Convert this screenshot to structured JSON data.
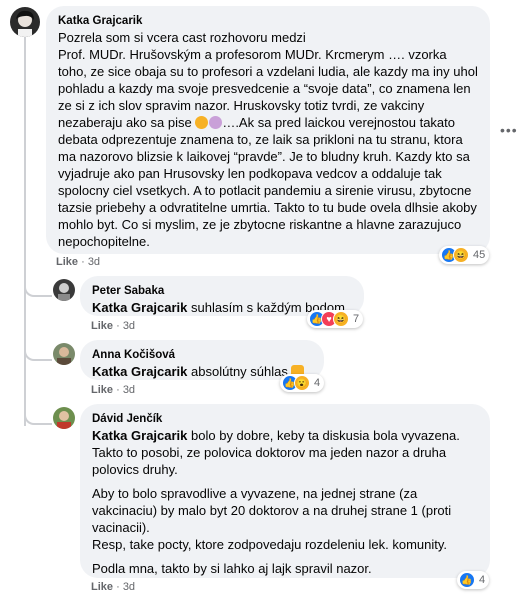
{
  "main_comment": {
    "author": "Katka Grajcarik",
    "text_before_emoji": "Pozrela som si vcera cast rozhovoru medzi\nProf. MUDr. Hrušovským a profesorom MUDr. Krcmerym …. vzorka toho, ze sice obaja su to profesori a vzdelani ludia, ale kazdy ma iny uhol pohladu a kazdy ma svoje presvedcenie a “svoje data”, co znamena len ze si z ich slov spravim nazor. Hruskovsky totiz tvrdi, ze vakciny nezaberaju ako sa pise ",
    "text_after_emoji": "….Ak sa pred laickou verejnostou takato debata odprezentuje znamena to, ze laik sa prikloni na tu stranu, ktora ma nazorovo blizsie k laikovej “pravde”. Je to bludny kruh. Kazdy kto sa vyjadruje ako pan Hrusovsky len podkopava vedcov a oddaluje tak spolocny ciel vsetkych. A to potlacit pandemiu a sirenie virusu, zbytocne tazsie priebehy a odvratitelne umrtia. Takto to tu bude ovela dlhsie akoby mohlo byt. Co si myslim, ze je zbytocne riskantne a hlavne zarazujuco nepochopitelne.",
    "like_label": "Like",
    "time": "3d",
    "reaction_count": "45",
    "more_label": "•••"
  },
  "replies": [
    {
      "author": "Peter Sabaka",
      "mention": "Katka Grajcarik",
      "text": " suhlasím s každým bodom",
      "like_label": "Like",
      "time": "3d",
      "reaction_count": "7"
    },
    {
      "author": "Anna Kočišová",
      "mention": "Katka Grajcarik",
      "text": " absolútny súhlas ",
      "like_label": "Like",
      "time": "3d",
      "reaction_count": "4"
    },
    {
      "author": "Dávid Jenčík",
      "mention": "Katka Grajcarik",
      "text_1": " bolo by dobre, keby ta diskusia bola vyvazena. Takto to posobi, ze polovica doktorov ma jeden nazor a druha polovics druhy.",
      "text_2": "Aby to bolo spravodlive a vyvazene, na jednej strane (za vakcinaciu) by malo byt 20 doktorov a na druhej strane 1 (proti vacinacii).\nResp, take pocty, ktore zodpovedaju rozdeleniu lek. komunity.",
      "text_3": "Podla mna, takto by si lahko aj lajk spravil nazor.",
      "like_label": "Like",
      "time": "3d",
      "reaction_count": "4"
    }
  ],
  "colors": {
    "bubble": "#f0f2f5",
    "like_blue": "#1877f2",
    "meta_gray": "#65676b"
  },
  "separator": "·"
}
